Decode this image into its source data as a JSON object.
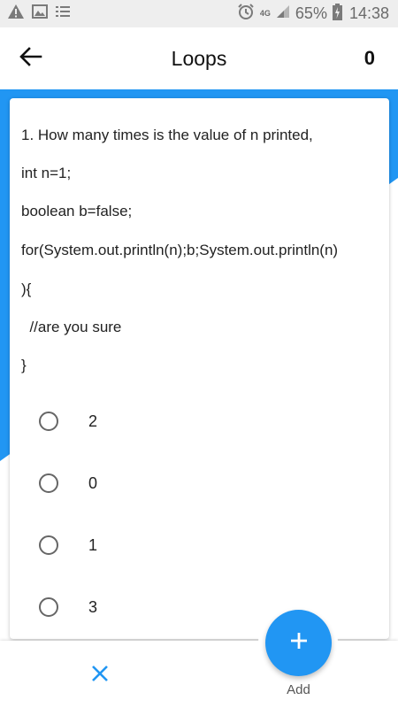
{
  "status_bar": {
    "network": "4G",
    "battery": "65%",
    "time": "14:38"
  },
  "app_bar": {
    "title": "Loops",
    "score": "0",
    "back_icon": "arrow-left-icon"
  },
  "question": {
    "lines": [
      "1. How many times is the value of n printed,",
      "int n=1;",
      "boolean b=false;",
      "for(System.out.println(n);b;System.out.println(n)",
      "){",
      "  //are you sure",
      "}"
    ],
    "options": [
      "2",
      "0",
      "1",
      "3"
    ]
  },
  "bottom_bar": {
    "close_icon": "close-icon",
    "add_label": "Add",
    "add_icon": "plus-icon"
  },
  "colors": {
    "accent": "#2196f3",
    "close": "#2196f3",
    "status_bar": "#eeeeee"
  }
}
